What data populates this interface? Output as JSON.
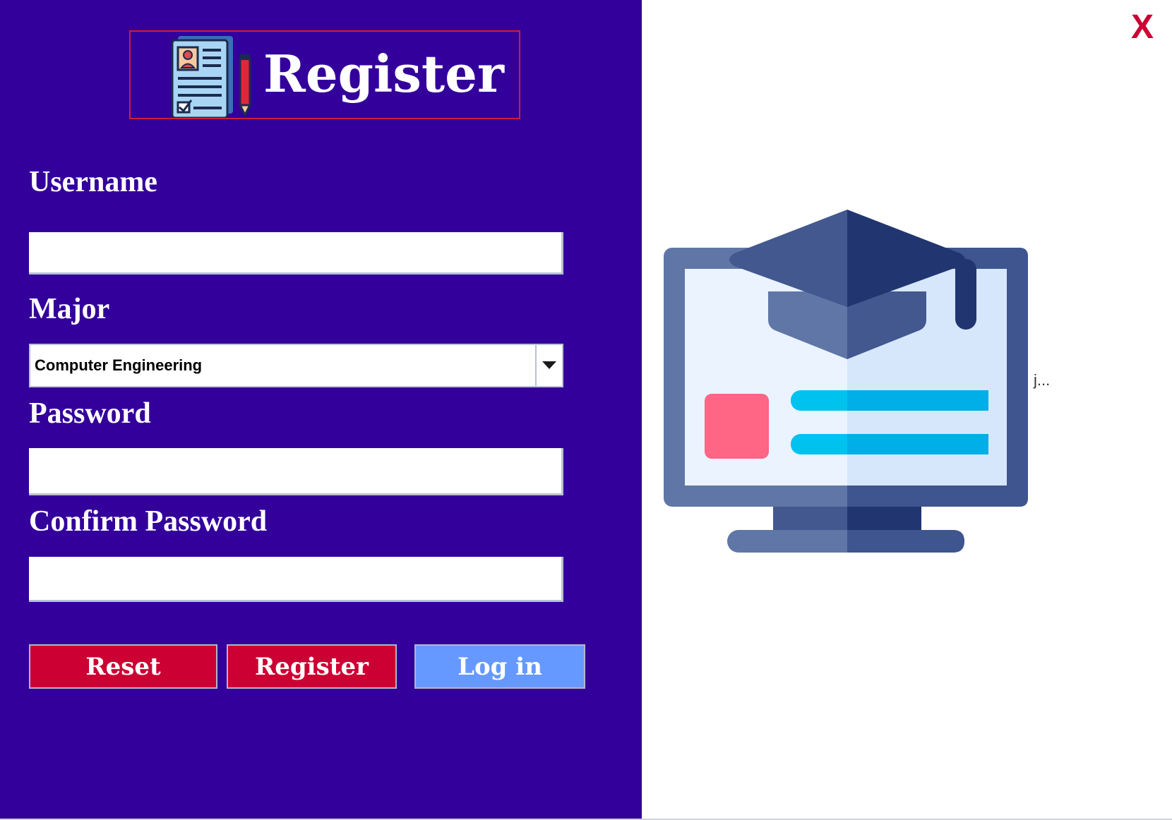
{
  "header": {
    "title": "Register",
    "icon": "registration-form-icon"
  },
  "form": {
    "username_label": "Username",
    "username_value": "",
    "major_label": "Major",
    "major_selected": "Computer Engineering",
    "password_label": "Password",
    "password_value": "",
    "confirm_password_label": "Confirm Password",
    "confirm_password_value": ""
  },
  "buttons": {
    "reset": "Reset",
    "register": "Register",
    "login": "Log in"
  },
  "window": {
    "close_label": "X"
  },
  "illustration": {
    "icon": "online-education-monitor-icon",
    "truncated_text": "j..."
  },
  "colors": {
    "panel_background": "#33009b",
    "accent_red": "#cc0033",
    "login_blue": "#6699ff",
    "header_border": "#cc1f3a"
  }
}
